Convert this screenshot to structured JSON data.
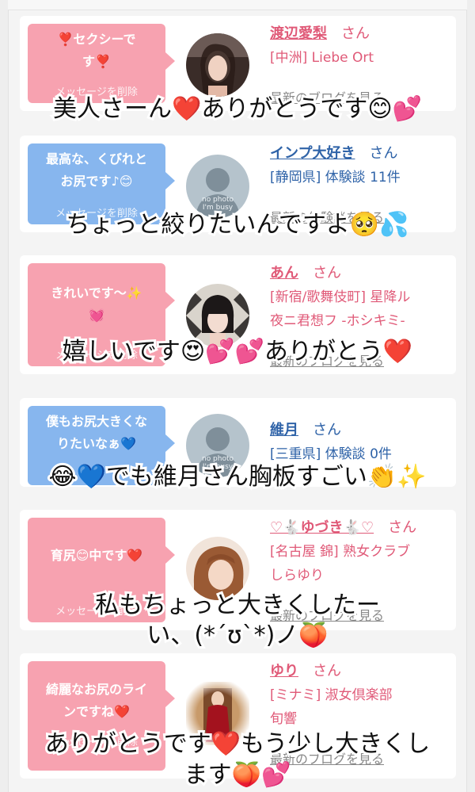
{
  "cards": [
    {
      "bubble_color": "pink",
      "message_lines": [
        "❣️セクシーで",
        "す❣️"
      ],
      "delete_label": "メッセージを削除",
      "name": "渡辺愛梨",
      "name_color": "pink",
      "san": "さん",
      "details": [
        "[中洲] Liebe Ort"
      ],
      "blog_label": "最新のブログを見る",
      "avatar": "photo-woman-long-hair"
    },
    {
      "bubble_color": "blue",
      "message_lines": [
        "最高な、くびれと",
        "お尻です♪😊"
      ],
      "delete_label": "メッセージを削除",
      "name": "インプ大好き",
      "name_color": "blue",
      "san": "さん",
      "details": [
        "[静岡県] 体験談 11件"
      ],
      "blog_label": "最新の体験談を見る",
      "avatar": "no-photo",
      "avatar_text": [
        "no photo",
        "I'm busy"
      ]
    },
    {
      "bubble_color": "pink",
      "message_lines": [
        "きれいです〜✨",
        "💓"
      ],
      "delete_label": "メッセージを削除",
      "name": "あん",
      "name_color": "pink",
      "san": "さん",
      "details": [
        "[新宿/歌舞伎町] 星降ル",
        "夜ニ君想フ -ホシキミ-"
      ],
      "blog_label": "最新のブログを見る",
      "avatar": "photo-woman-bob"
    },
    {
      "bubble_color": "blue",
      "message_lines": [
        "僕もお尻大きくな",
        "りたいなぁ💙"
      ],
      "delete_label": "",
      "name": "維月",
      "name_color": "blue",
      "san": "さん",
      "details": [
        "[三重県] 体験談 0件"
      ],
      "blog_label": "",
      "avatar": "no-photo",
      "avatar_text": [
        "no photo",
        "I'm busy"
      ]
    },
    {
      "bubble_color": "pink",
      "message_lines": [
        "育尻😊中です❤️"
      ],
      "delete_label": "メッセージを削除",
      "name": "♡🐇ゆづき🐇♡",
      "name_color": "pink",
      "san": "さん",
      "details": [
        "[名古屋 錦] 熟女クラブ",
        "しらゆり"
      ],
      "blog_label": "最新のブログを見る",
      "avatar": "photo-woman-brown"
    },
    {
      "bubble_color": "pink",
      "message_lines": [
        "綺麗なお尻のライ",
        "ンですね❤️"
      ],
      "delete_label": "メッセージを削除",
      "name": "ゆり",
      "name_color": "pink",
      "san": "さん",
      "details": [
        "[ミナミ] 淑女倶楽部",
        "旬響"
      ],
      "blog_label": "最新のブログを見る",
      "avatar": "photo-woman-red-dress"
    }
  ],
  "overlays": [
    "美人さーん❤️ありがとうです😊💕",
    "ちょっと絞りたいんですよ🥺💦",
    "嬉しいです😍💕💕ありがとう❤️",
    "😂💙でも維月さん胸板すごい👏✨",
    "私もちょっと大きくしたー",
    "い、(*´ʊ`*)ノ🍑",
    "ありがとうです❤️もう少し大きくし",
    "ます🍑💕"
  ],
  "colors": {
    "pink_bubble": "#f7a2b0",
    "blue_bubble": "#87b6ee",
    "pink_text": "#e05a78",
    "blue_text": "#2f63a8"
  }
}
